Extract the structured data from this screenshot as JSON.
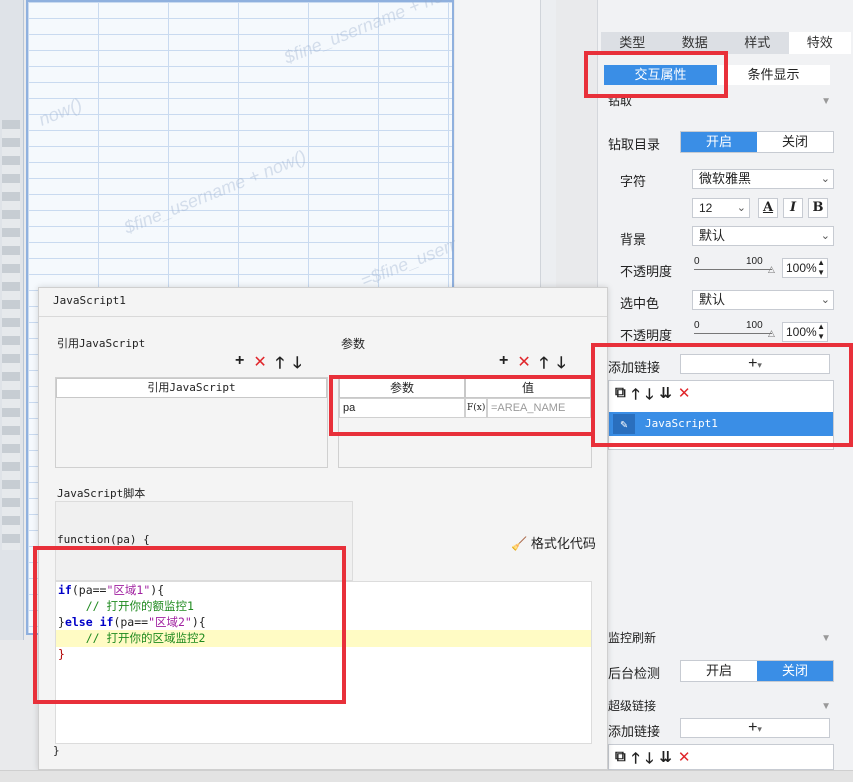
{
  "background": {
    "watermark_texts": [
      "$fine_username + now()",
      "now()",
      "$fine_username + now()",
      "=$fine_usern"
    ]
  },
  "panel": {
    "tabs": [
      "类型",
      "数据",
      "样式",
      "特效"
    ],
    "active_tab": "特效",
    "subtabs": [
      "交互属性",
      "条件显示"
    ],
    "drill_section": "钻取",
    "drill_dir_label": "钻取目录",
    "drill_toggle": [
      "开启",
      "关闭"
    ],
    "font_label": "字符",
    "font_value": "微软雅黑",
    "font_size": "12",
    "fmt_buttons": [
      "A",
      "I",
      "B"
    ],
    "bg_label": "背景",
    "bg_value": "默认",
    "opacity_label": "不透明度",
    "opacity_low": "0",
    "opacity_high": "100",
    "opacity_value": "100%",
    "selcolor_label": "选中色",
    "selcolor_value": "默认",
    "opacity2_label": "不透明度",
    "opacity2_low": "0",
    "opacity2_high": "100",
    "opacity2_value": "100%",
    "add_link_label": "添加链接",
    "add_link_btn": "+",
    "link_items": [
      "JavaScript1"
    ],
    "monitor_section": "监控刷新",
    "backend_label": "后台检测",
    "backend_toggle": [
      "开启",
      "关闭"
    ],
    "hyperlink_section": "超级链接",
    "add_link_label2": "添加链接",
    "add_link_btn2": "+"
  },
  "dialog": {
    "title": "JavaScript1",
    "ref_js_label": "引用JavaScript",
    "ref_js_header": "引用JavaScript",
    "params_label": "参数",
    "params_header_name": "参数",
    "params_header_value": "值",
    "param_name": "pa",
    "param_fx": "F(x)",
    "param_value_placeholder": "=AREA_NAME",
    "script_label": "JavaScript脚本",
    "function_sig": "function(pa) {",
    "format_code_btn": "格式化代码",
    "code": {
      "l1_kw": "if",
      "l1_a": "(pa==",
      "l1_str": "\"区域1\"",
      "l1_b": "){",
      "l2": "    // 打开你的额监控1",
      "l3_a": "}",
      "l3_kw1": "else",
      "l3_kw2": "if",
      "l3_b": "(pa==",
      "l3_str": "\"区域2\"",
      "l3_c": "){",
      "l4": "    // 打开你的区域监控2",
      "l5": "}"
    },
    "closing_brace": "}"
  },
  "colors": {
    "accent": "#3a8ee6",
    "highlight_red": "#e8303a",
    "delete_red": "#e0262b"
  }
}
